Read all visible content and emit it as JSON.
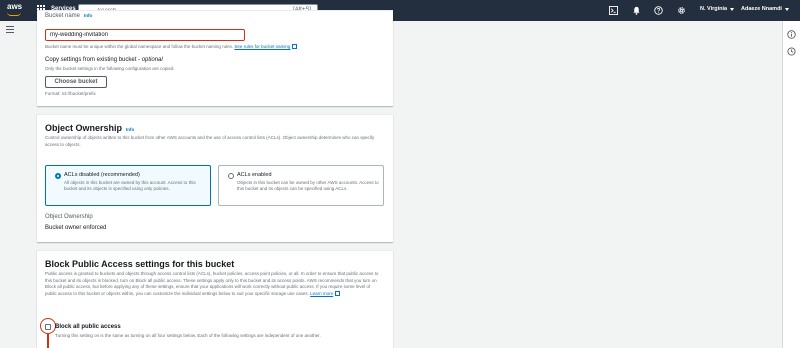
{
  "topnav": {
    "logo": "aws",
    "services_label": "Services",
    "search_placeholder": "Search",
    "search_shortcut": "[Alt+S]",
    "region": "N. Virginia",
    "account": "Adaeze Nnamdi"
  },
  "general": {
    "bucket_name_label": "Bucket name",
    "info": "Info",
    "bucket_name_value": "my-wedding-invitation",
    "bucket_name_hint": "Bucket name must be unique within the global namespace and follow the bucket naming rules.",
    "rules_link": "See rules for bucket naming",
    "copy_label": "Copy settings from existing bucket",
    "copy_optional": " - optional",
    "copy_hint": "Only the bucket settings in the following configuration are copied.",
    "choose_button": "Choose bucket",
    "format_hint": "Format: s3://bucket/prefix"
  },
  "ownership": {
    "title": "Object Ownership",
    "info": "Info",
    "description": "Control ownership of objects written to this bucket from other AWS accounts and the use of access control lists (ACLs). Object ownership determines who can specify access to objects.",
    "option_disabled_title": "ACLs disabled (recommended)",
    "option_disabled_desc": "All objects in this bucket are owned by this account. Access to this bucket and its objects is specified using only policies.",
    "option_enabled_title": "ACLs enabled",
    "option_enabled_desc": "Objects in this bucket can be owned by other AWS accounts. Access to this bucket and its objects can be specified using ACLs.",
    "owner_label": "Object Ownership",
    "owner_value": "Bucket owner enforced"
  },
  "public_access": {
    "title": "Block Public Access settings for this bucket",
    "description": "Public access is granted to buckets and objects through access control lists (ACLs), bucket policies, access point policies, or all. In order to ensure that public access to this bucket and its objects is blocked, turn on Block all public access. These settings apply only to this bucket and its access points. AWS recommends that you turn on Block all public access, but before applying any of these settings, ensure that your applications will work correctly without public access. If you require some level of public access to this bucket or objects within, you can customize the individual settings below to suit your specific storage use cases.",
    "learn_more": "Learn more",
    "block_all_label": "Block all public access",
    "block_all_desc": "Turning this setting on is the same as turning on all four settings below. Each of the following settings are independent of one another."
  },
  "colors": {
    "nav_bg": "#232f3e",
    "accent": "#0073bb",
    "highlight": "#d13212",
    "aws_orange": "#ff9900"
  }
}
